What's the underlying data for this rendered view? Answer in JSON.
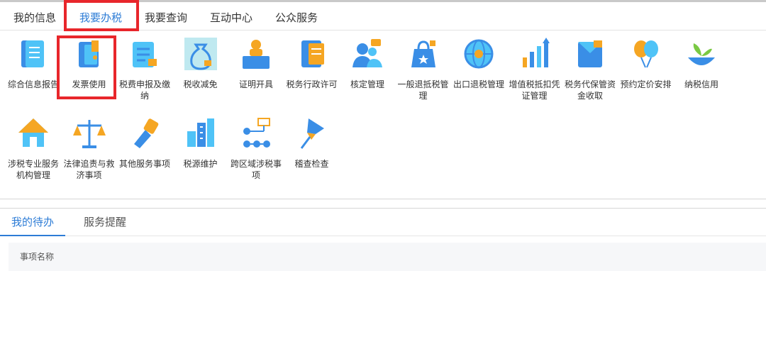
{
  "tabs": [
    "我的信息",
    "我要办税",
    "我要查询",
    "互动中心",
    "公众服务"
  ],
  "active_tab_index": 1,
  "colors": {
    "accent": "#2d7cd6",
    "highlight": "#e8262b",
    "icon_blue": "#3a8ee6",
    "icon_orange": "#f5a623",
    "icon_cyan": "#4fc3f7"
  },
  "icons": [
    {
      "label": "综合信息报告",
      "icon": "report-book-icon"
    },
    {
      "label": "发票使用",
      "icon": "invoice-icon"
    },
    {
      "label": "税费申报及缴纳",
      "icon": "tax-declare-icon"
    },
    {
      "label": "税收减免",
      "icon": "tax-reduction-bag-icon"
    },
    {
      "label": "证明开具",
      "icon": "certificate-desk-icon"
    },
    {
      "label": "税务行政许可",
      "icon": "notebook-icon"
    },
    {
      "label": "核定管理",
      "icon": "users-approve-icon"
    },
    {
      "label": "一般退抵税管理",
      "icon": "tax-refund-bag-icon"
    },
    {
      "label": "出口退税管理",
      "icon": "globe-icon"
    },
    {
      "label": "增值税抵扣凭证管理",
      "icon": "vat-growth-chart-icon"
    },
    {
      "label": "税务代保管资金收取",
      "icon": "deposit-envelope-icon"
    },
    {
      "label": "预约定价安排",
      "icon": "balloons-icon"
    },
    {
      "label": "纳税信用",
      "icon": "sprout-icon"
    },
    {
      "label": "涉税专业服务机构管理",
      "icon": "house-tools-icon"
    },
    {
      "label": "法律追责与救济事项",
      "icon": "scales-icon"
    },
    {
      "label": "其他服务事项",
      "icon": "hand-tool-icon"
    },
    {
      "label": "税源维护",
      "icon": "buildings-icon"
    },
    {
      "label": "跨区域涉税事项",
      "icon": "flowchart-icon"
    },
    {
      "label": "稽查检查",
      "icon": "pushpin-icon"
    }
  ],
  "tabs2": [
    "我的待办",
    "服务提醒"
  ],
  "active_tab2_index": 0,
  "table": {
    "headers": [
      "事项名称"
    ]
  }
}
